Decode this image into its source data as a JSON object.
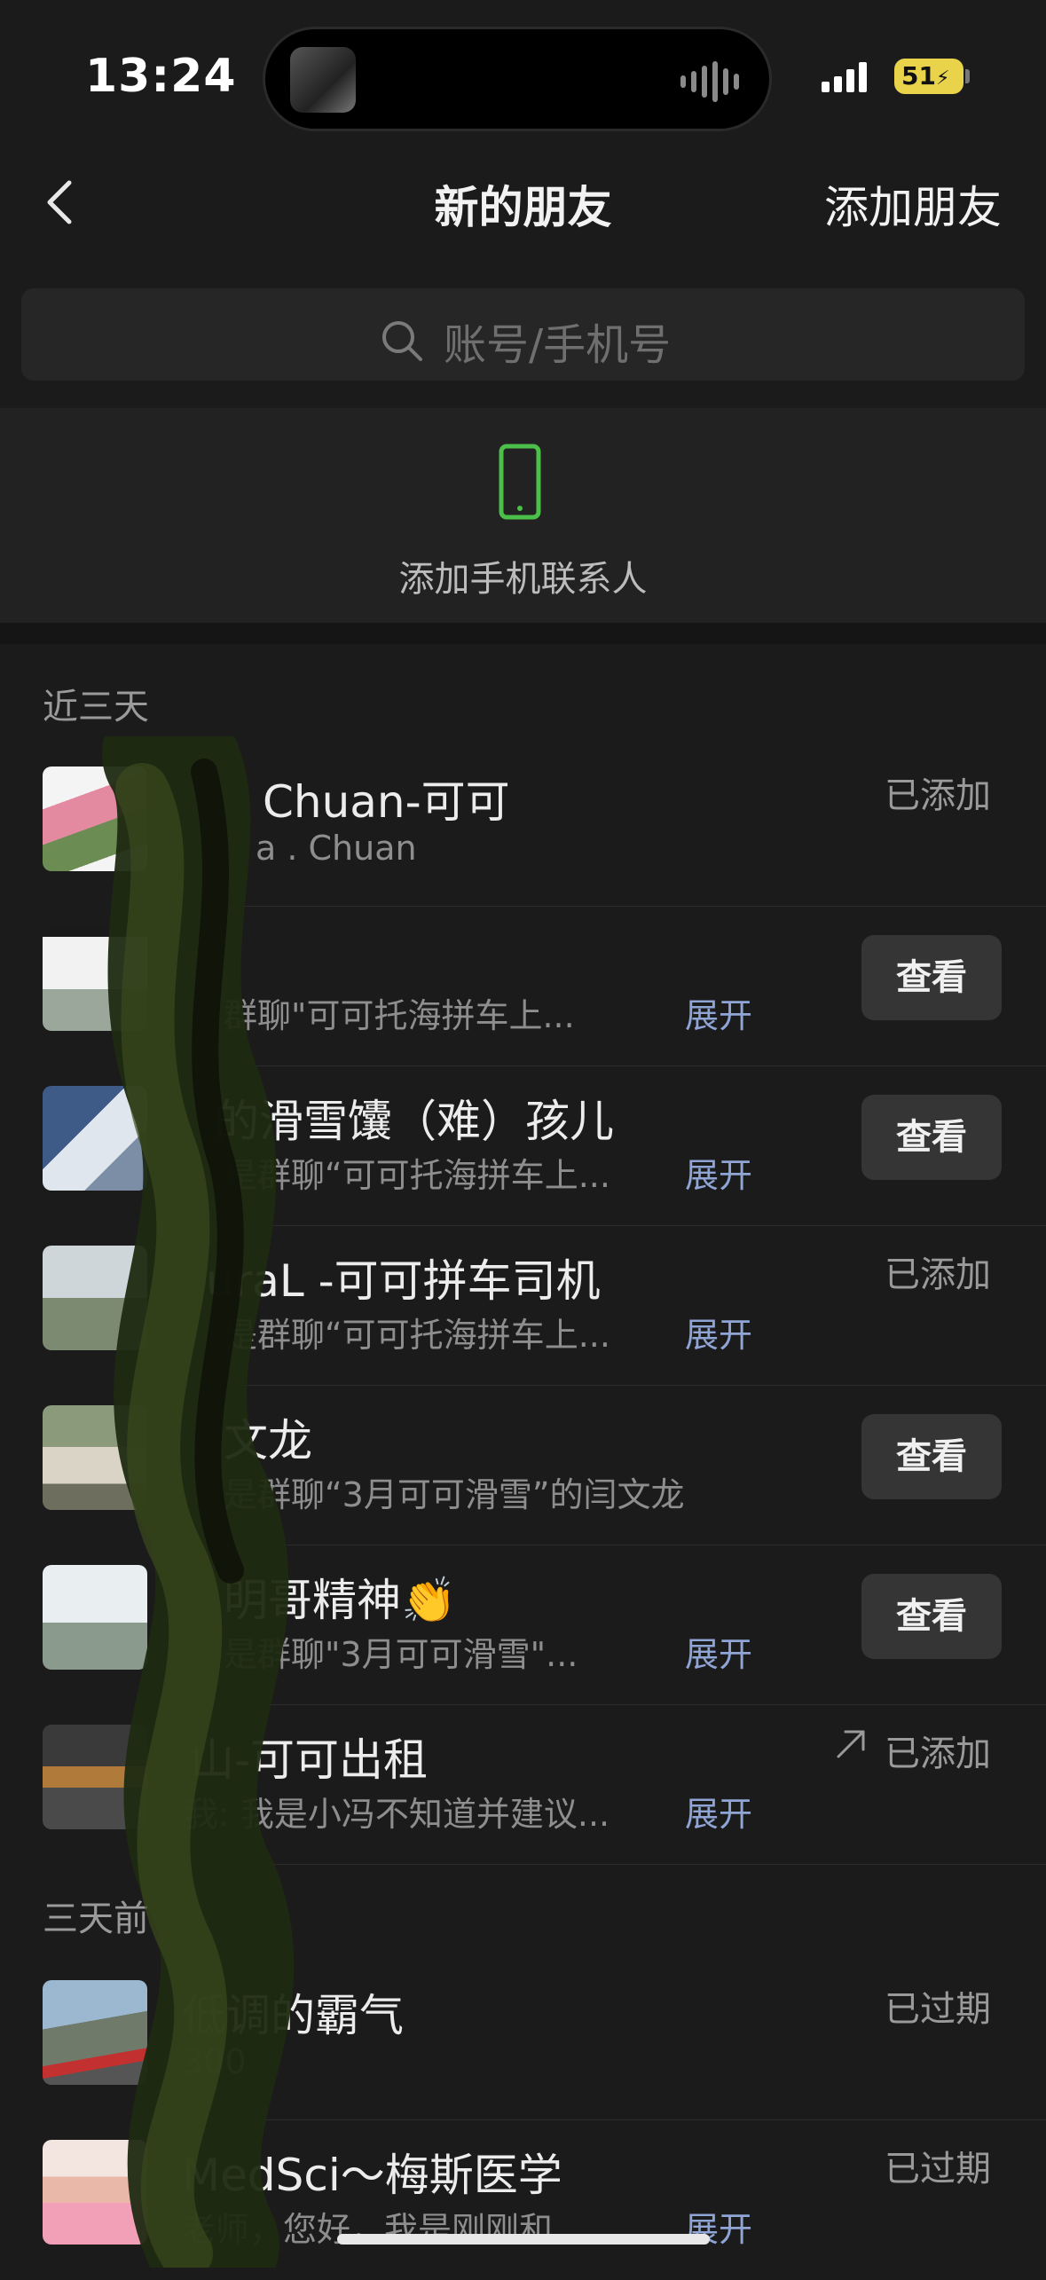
{
  "status_bar": {
    "time": "13:24",
    "battery": "51"
  },
  "nav": {
    "title": "新的朋友",
    "add_friend": "添加朋友"
  },
  "search": {
    "placeholder": "账号/手机号"
  },
  "phone_contacts": {
    "label": "添加手机联系人"
  },
  "sections": {
    "recent_label": "近三天",
    "older_label": "三天前"
  },
  "recent": [
    {
      "name": "Chuan-可可",
      "sub": "a . Chuan",
      "expand": "",
      "status": "已添加",
      "action": ""
    },
    {
      "name": "",
      "sub": "群聊\"可可托海拼车上...",
      "expand": "展开",
      "status": "",
      "action": "查看"
    },
    {
      "name": "的滑雪馕（难）孩儿",
      "sub": "是群聊“可可托海拼车上...",
      "expand": "展开",
      "status": "",
      "action": "查看"
    },
    {
      "name": "uraL -可可拼车司机",
      "sub": "是群聊“可可托海拼车上...",
      "expand": "展开",
      "status": "已添加",
      "action": ""
    },
    {
      "name": "文龙",
      "sub": "是群聊“3月可可滑雪”的闫文龙",
      "expand": "",
      "status": "",
      "action": "查看"
    },
    {
      "name": "明哥精神👏",
      "sub": "是群聊\"3月可可滑雪\"...",
      "expand": "展开",
      "status": "",
      "action": "查看"
    },
    {
      "name": "山-可可出租",
      "sub": "我: 我是小冯不知道并建议...",
      "expand": "展开",
      "status": "已添加",
      "action": ""
    }
  ],
  "older": [
    {
      "name": "低调的霸气",
      "sub": "300",
      "expand": "",
      "status": "已过期",
      "action": ""
    },
    {
      "name": "MedSci～梅斯医学",
      "sub": "老师，您好，我是刚刚和",
      "expand": "展开",
      "status": "已过期",
      "action": ""
    }
  ]
}
